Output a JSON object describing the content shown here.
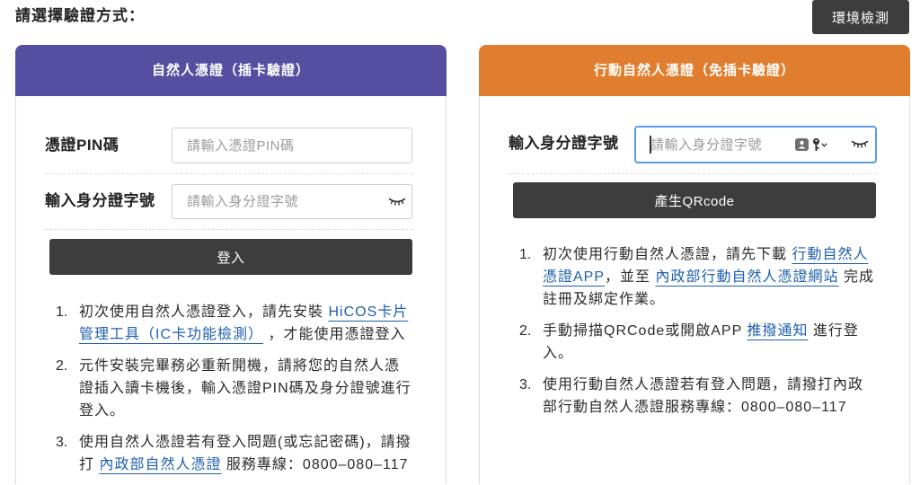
{
  "header": {
    "title": "請選擇驗證方式：",
    "env_check_button": "環境檢測"
  },
  "card_reader": {
    "title": "自然人憑證（插卡驗證）",
    "pin": {
      "label": "憑證PIN碼",
      "placeholder": "請輸入憑證PIN碼",
      "value": ""
    },
    "id_number": {
      "label": "輸入身分證字號",
      "placeholder": "請輸入身分證字號",
      "value": "",
      "toggle_icon": "eye-closed-icon"
    },
    "login_button": "登入",
    "instructions": [
      {
        "num": "1.",
        "pre": "初次使用自然人憑證登入，請先安裝 ",
        "link": "HiCOS卡片管理工具（IC卡功能檢測）",
        "post": " ，才能使用憑證登入"
      },
      {
        "num": "2.",
        "pre": "元件安裝完畢務必重新開機，請將您的自然人憑證插入讀卡機後，輸入憑證PIN碼及身分證號進行登入。"
      },
      {
        "num": "3.",
        "pre": "使用自然人憑證若有登入問題(或忘記密碼)，請撥打 ",
        "link": "內政部自然人憑證",
        "post": " 服務專線：0800–080–117"
      }
    ]
  },
  "mobile": {
    "title": "行動自然人憑證（免插卡驗證）",
    "id_number": {
      "label": "輸入身分證字號",
      "placeholder": "請輸入身分證字號",
      "value": "",
      "focused": true,
      "icons": [
        "password-manager-icon",
        "key-icon",
        "chevron-down-icon",
        "eye-closed-icon"
      ]
    },
    "qrcode_button": "產生QRcode",
    "instructions": [
      {
        "num": "1.",
        "pre": "初次使用行動自然人憑證，請先下載 ",
        "link": "行動自然人憑證APP",
        "mid": "，並至 ",
        "link2": "內政部行動自然人憑證網站",
        "post": " 完成註冊及綁定作業。"
      },
      {
        "num": "2.",
        "pre": "手動掃描QRCode或開啟APP ",
        "link": "推撥通知",
        "post": " 進行登入。"
      },
      {
        "num": "3.",
        "pre": "使用行動自然人憑證若有登入問題，請撥打內政部行動自然人憑證服務專線：0800–080–117"
      }
    ]
  },
  "colors": {
    "card_reader_header": "#564ea0",
    "mobile_header": "#e07d2e",
    "button": "#3d3d3d",
    "link": "#1e5fae",
    "focus_border": "#5b9ce2"
  }
}
